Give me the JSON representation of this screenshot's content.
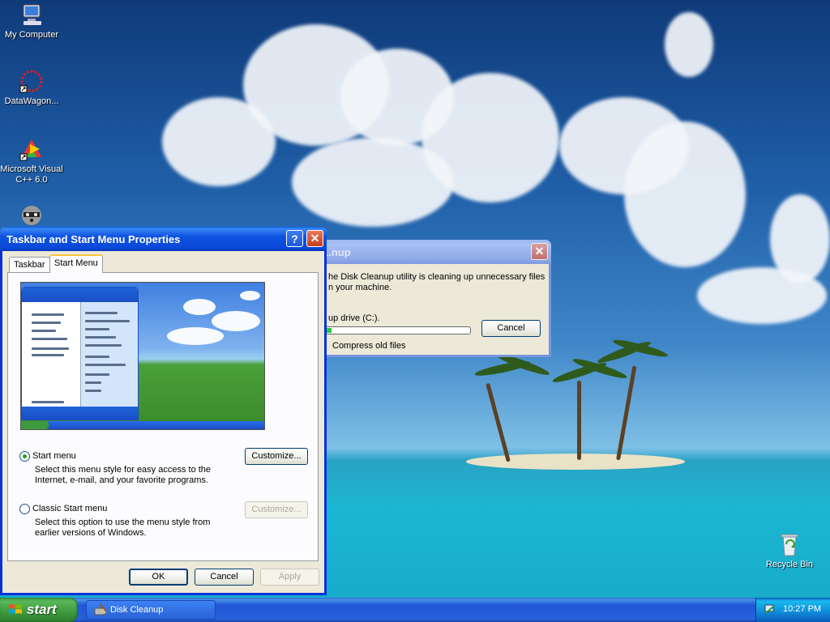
{
  "desktop": {
    "icons": [
      {
        "label": "My Computer",
        "icon": "my-computer-icon"
      },
      {
        "label": "DataWagon...",
        "icon": "datawagon-icon"
      },
      {
        "label": "Microsoft Visual C++ 6.0",
        "icon": "visual-cpp-icon"
      },
      {
        "label": "",
        "icon": "raccoon-icon"
      },
      {
        "label": "Recycle Bin",
        "icon": "recycle-bin-icon"
      }
    ]
  },
  "taskbar_dialog": {
    "title": "Taskbar and Start Menu Properties",
    "tabs": [
      {
        "label": "Taskbar",
        "active": false
      },
      {
        "label": "Start Menu",
        "active": true
      }
    ],
    "options": {
      "start_menu": {
        "label": "Start menu",
        "selected": true,
        "description_line1": "Select this menu style for easy access to the",
        "description_line2": "Internet, e-mail, and your favorite programs.",
        "customize_label": "Customize..."
      },
      "classic_menu": {
        "label": "Classic Start menu",
        "selected": false,
        "description_line1": "Select this option to use the menu style from",
        "description_line2": "earlier versions of Windows.",
        "customize_label": "Customize..."
      }
    },
    "buttons": {
      "ok": "OK",
      "cancel": "Cancel",
      "apply": "Apply"
    }
  },
  "cleanup_dialog": {
    "title": "...nup",
    "message_line1": "he Disk Cleanup utility is cleaning up unnecessary files",
    "message_line2": "n your machine.",
    "drive_label": "up drive  (C:).",
    "progress": 0.04,
    "status": "Compress old files",
    "cancel_label": "Cancel"
  },
  "taskbar": {
    "start_label": "start",
    "items": [
      {
        "label": "Disk Cleanup",
        "icon": "disk-cleanup-icon"
      }
    ],
    "clock": "10:27 PM"
  },
  "colors": {
    "xp_blue": "#0831d9",
    "start_green": "#3c9a3c",
    "dialog_face": "#ece9d8",
    "progress_green": "#29c53c"
  }
}
